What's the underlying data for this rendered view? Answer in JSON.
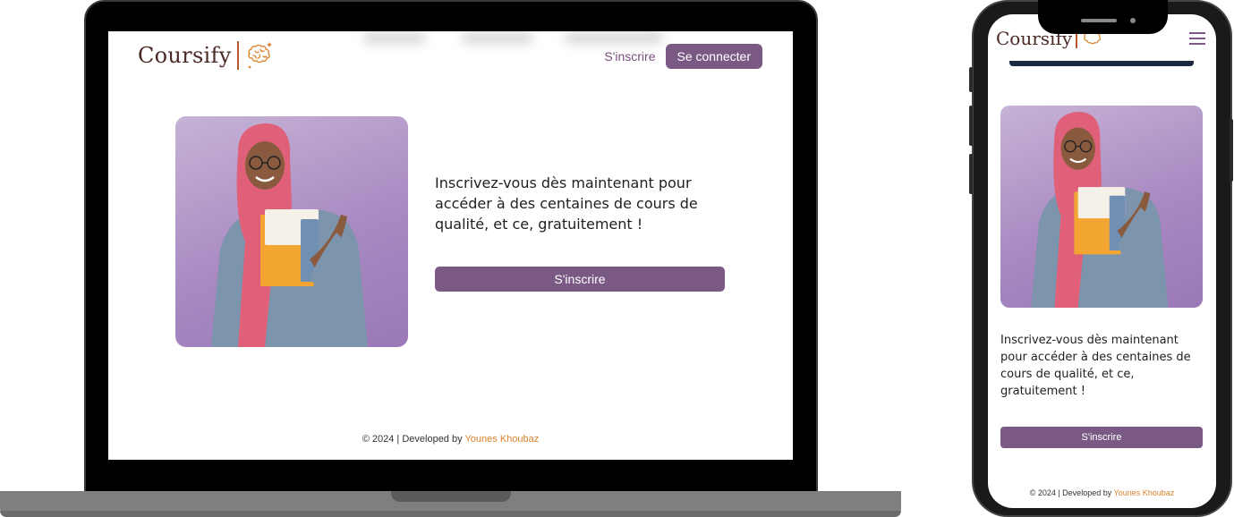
{
  "brand": {
    "name": "Coursify",
    "accent": "#7b5985",
    "logo_color": "#4a2a24",
    "author_color": "#d9822b"
  },
  "header": {
    "signup_link": "S'inscrire",
    "login_button": "Se connecter"
  },
  "hero": {
    "headline": "Inscrivez-vous dès maintenant pour accéder à des centaines de cours de qualité, et ce, gratuitement !",
    "cta_button": "S'inscrire"
  },
  "footer": {
    "copyright": "© 2024 | Developed by ",
    "author": "Younes Khoubaz"
  },
  "mobile": {
    "headline": "Inscrivez-vous dès maintenant pour accéder à des centaines de cours de qualité, et ce, gratuitement !",
    "cta_button": "S'inscrire",
    "menu_icon": "hamburger-icon"
  }
}
